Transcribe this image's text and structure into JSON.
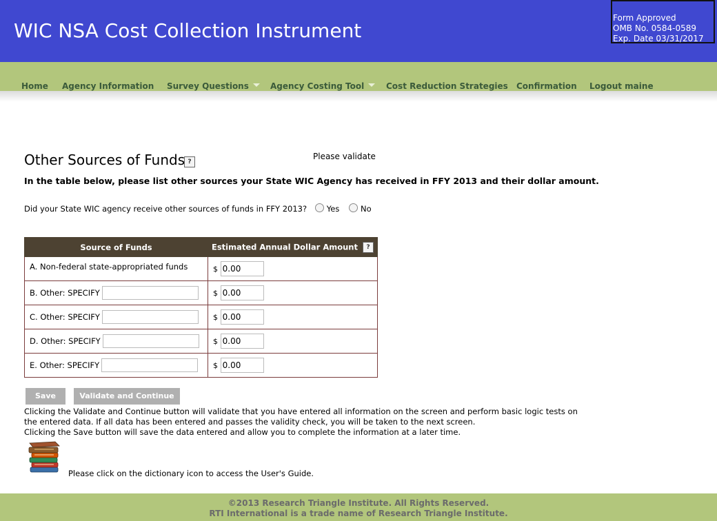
{
  "header": {
    "title": "WIC NSA Cost Collection Instrument",
    "omb": {
      "line1": "Form Approved",
      "line2": "OMB No. 0584-0589",
      "line3": "Exp. Date 03/31/2017"
    }
  },
  "nav": {
    "items": [
      {
        "label": "Home",
        "has_dropdown": false
      },
      {
        "label": "Agency Information",
        "has_dropdown": false
      },
      {
        "label": "Survey Questions",
        "has_dropdown": true
      },
      {
        "label": "Agency Costing Tool",
        "has_dropdown": true
      },
      {
        "label": "Cost Reduction Strategies",
        "has_dropdown": false
      },
      {
        "label": "Confirmation",
        "has_dropdown": false
      },
      {
        "label": "Logout maine",
        "has_dropdown": false
      }
    ]
  },
  "page": {
    "title": "Other Sources of Funds",
    "help_label": "?",
    "validate_note": "Please validate",
    "instruction": "In the table below, please list other sources your State WIC Agency has received in FFY 2013 and their dollar amount.",
    "question": "Did your State WIC agency receive other sources of funds in FFY 2013?",
    "options": {
      "yes": "Yes",
      "no": "No"
    }
  },
  "table": {
    "headers": {
      "source": "Source of Funds",
      "amount": "Estimated Annual Dollar Amount"
    },
    "currency": "$",
    "rows": [
      {
        "label": "A. Non-federal state-appropriated funds",
        "specify": null,
        "amount": "0.00"
      },
      {
        "label": "B. Other: SPECIFY",
        "specify": "",
        "amount": "0.00"
      },
      {
        "label": "C. Other: SPECIFY",
        "specify": "",
        "amount": "0.00"
      },
      {
        "label": "D. Other: SPECIFY",
        "specify": "",
        "amount": "0.00"
      },
      {
        "label": "E. Other: SPECIFY",
        "specify": "",
        "amount": "0.00"
      }
    ]
  },
  "buttons": {
    "save": "Save",
    "validate": "Validate and Continue"
  },
  "help": {
    "line1": "Clicking the Validate and Continue button will validate that you have entered all information on the screen and perform basic logic tests on the entered data. If all data has been entered and passes the validity check, you will be taken to the next screen.",
    "line2": "Clicking the Save button will save the data entered and allow you to complete the information at a later time.",
    "guide": "Please click on the dictionary icon to access the User's Guide."
  },
  "footer": {
    "line1": "©2013 Research Triangle Institute. All Rights Reserved.",
    "line2": "RTI International is a trade name of Research Triangle Institute."
  },
  "colors": {
    "header_bg": "#4048d0",
    "nav_bg": "#b2c67c",
    "table_header_bg": "#4d4232",
    "button_bg": "#b0b0b0"
  }
}
